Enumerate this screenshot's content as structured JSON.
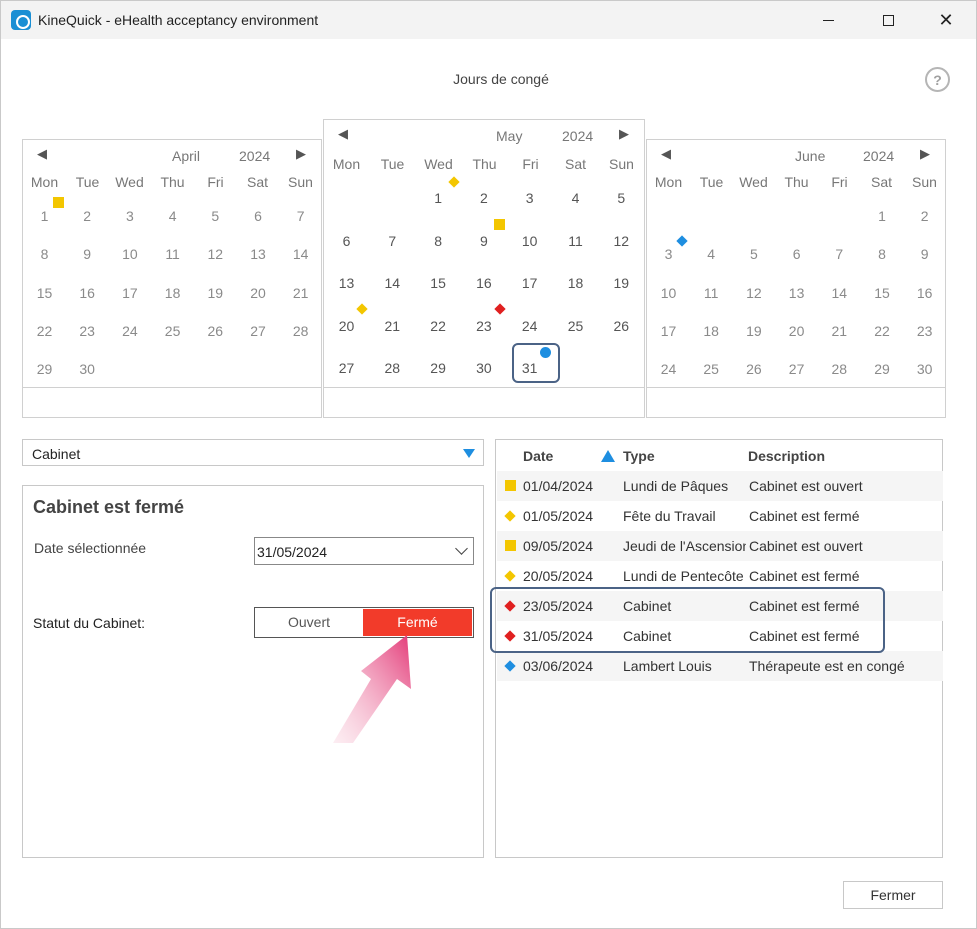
{
  "window": {
    "title": "KineQuick - eHealth acceptancy environment",
    "min_glyph": "",
    "max_glyph": "",
    "close_glyph": "✕"
  },
  "dialog": {
    "title": "Jours de congé",
    "help": "?"
  },
  "calendars": {
    "prev_glyph": "◀",
    "next_glyph": "▶",
    "weekdays": [
      "Mon",
      "Tue",
      "Wed",
      "Thu",
      "Fri",
      "Sat",
      "Sun"
    ],
    "april": {
      "month": "April",
      "year": "2024",
      "days": [
        "1",
        "2",
        "3",
        "4",
        "5",
        "6",
        "7",
        "8",
        "9",
        "10",
        "11",
        "12",
        "13",
        "14",
        "15",
        "16",
        "17",
        "18",
        "19",
        "20",
        "21",
        "22",
        "23",
        "24",
        "25",
        "26",
        "27",
        "28",
        "29",
        "30"
      ]
    },
    "may": {
      "month": "May",
      "year": "2024",
      "days": [
        "1",
        "2",
        "3",
        "4",
        "5",
        "6",
        "7",
        "8",
        "9",
        "10",
        "11",
        "12",
        "13",
        "14",
        "15",
        "16",
        "17",
        "18",
        "19",
        "20",
        "21",
        "22",
        "23",
        "24",
        "25",
        "26",
        "27",
        "28",
        "29",
        "30",
        "31"
      ],
      "selected": "31"
    },
    "june": {
      "month": "June",
      "year": "2024",
      "days": [
        "1",
        "2",
        "3",
        "4",
        "5",
        "6",
        "7",
        "8",
        "9",
        "10",
        "11",
        "12",
        "13",
        "14",
        "15",
        "16",
        "17",
        "18",
        "19",
        "20",
        "21",
        "22",
        "23",
        "24",
        "25",
        "26",
        "27",
        "28",
        "29",
        "30"
      ]
    }
  },
  "cabinet_select": {
    "value": "Cabinet"
  },
  "status_panel": {
    "header": "Cabinet est fermé",
    "date_label": "Date sélectionnée",
    "date_value": "31/05/2024",
    "statut_label": "Statut du Cabinet:",
    "option_open": "Ouvert",
    "option_closed": "Fermé",
    "selected": "Fermé"
  },
  "list": {
    "headers": {
      "date": "Date",
      "type": "Type",
      "description": "Description"
    },
    "rows": [
      {
        "date": "01/04/2024",
        "type": "Lundi de Pâques",
        "description": "Cabinet est ouvert",
        "marker": "square-yellow"
      },
      {
        "date": "01/05/2024",
        "type": "Fête du Travail",
        "description": "Cabinet est fermé",
        "marker": "diamond-yellow"
      },
      {
        "date": "09/05/2024",
        "type": "Jeudi de l'Ascension",
        "description": "Cabinet est ouvert",
        "marker": "square-yellow"
      },
      {
        "date": "20/05/2024",
        "type": "Lundi de Pentecôte",
        "description": "Cabinet est fermé",
        "marker": "diamond-yellow"
      },
      {
        "date": "23/05/2024",
        "type": "Cabinet",
        "description": "Cabinet est fermé",
        "marker": "diamond-red"
      },
      {
        "date": "31/05/2024",
        "type": "Cabinet",
        "description": "Cabinet est fermé",
        "marker": "diamond-red"
      },
      {
        "date": "03/06/2024",
        "type": "Lambert Louis",
        "description": "Thérapeute est en congé",
        "marker": "diamond-blue"
      }
    ]
  },
  "colors": {
    "accent_blue": "#1e8ee0",
    "closed_red": "#f23b2a",
    "holiday_yellow": "#f3c600",
    "highlight_border": "#4b6386"
  },
  "footer": {
    "close_label": "Fermer"
  }
}
